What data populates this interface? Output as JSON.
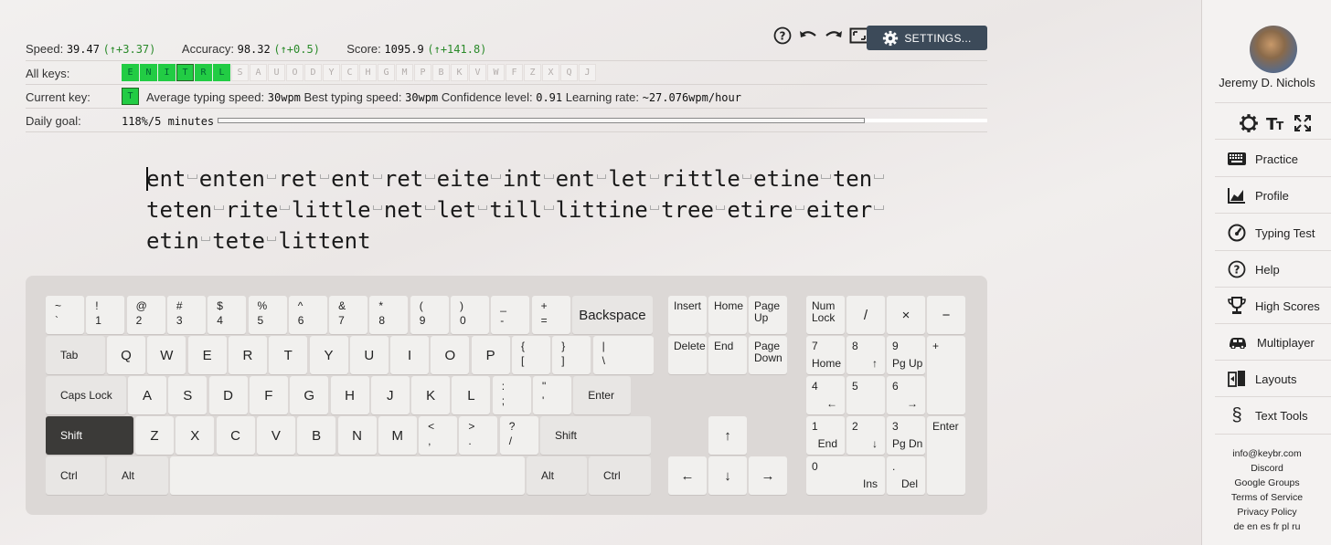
{
  "stats": {
    "speed_label": "Speed:",
    "speed_value": "39.47",
    "speed_delta": "(↑+3.37)",
    "accuracy_label": "Accuracy:",
    "accuracy_value": "98.32",
    "accuracy_delta": "(↑+0.5)",
    "score_label": "Score:",
    "score_value": "1095.9",
    "score_delta": "(↑+141.8)"
  },
  "toolbar": {
    "settings_label": "SETTINGS..."
  },
  "all_keys": {
    "label": "All keys:",
    "keys": [
      {
        "k": "E",
        "on": true
      },
      {
        "k": "N",
        "on": true
      },
      {
        "k": "I",
        "on": true
      },
      {
        "k": "T",
        "on": true,
        "current": true
      },
      {
        "k": "R",
        "on": true
      },
      {
        "k": "L",
        "on": true
      },
      {
        "k": "S",
        "on": false
      },
      {
        "k": "A",
        "on": false
      },
      {
        "k": "U",
        "on": false
      },
      {
        "k": "O",
        "on": false
      },
      {
        "k": "D",
        "on": false
      },
      {
        "k": "Y",
        "on": false
      },
      {
        "k": "C",
        "on": false
      },
      {
        "k": "H",
        "on": false
      },
      {
        "k": "G",
        "on": false
      },
      {
        "k": "M",
        "on": false
      },
      {
        "k": "P",
        "on": false
      },
      {
        "k": "B",
        "on": false
      },
      {
        "k": "K",
        "on": false
      },
      {
        "k": "V",
        "on": false
      },
      {
        "k": "W",
        "on": false
      },
      {
        "k": "F",
        "on": false
      },
      {
        "k": "Z",
        "on": false
      },
      {
        "k": "X",
        "on": false
      },
      {
        "k": "Q",
        "on": false
      },
      {
        "k": "J",
        "on": false
      }
    ]
  },
  "current_key": {
    "label": "Current key:",
    "key": "T",
    "avg_label": "Average typing speed:",
    "avg_value": "30wpm",
    "best_label": "Best typing speed:",
    "best_value": "30wpm",
    "conf_label": "Confidence level:",
    "conf_value": "0.91",
    "rate_label": "Learning rate:",
    "rate_value": "~27.076wpm/hour"
  },
  "daily_goal": {
    "label": "Daily goal:",
    "value": "118%/5 minutes",
    "progress": 1.18
  },
  "practice_text": {
    "lines": [
      "ent enten ret ent ret eite int ent let rittle etine ten ",
      "teten rite little net let till littine tree etire eiter ",
      "etin tete littent"
    ]
  },
  "keyboard": {
    "row1": [
      [
        "~",
        "`"
      ],
      [
        "!",
        "1"
      ],
      [
        "@",
        "2"
      ],
      [
        "#",
        "3"
      ],
      [
        "$",
        "4"
      ],
      [
        "%",
        "5"
      ],
      [
        "^",
        "6"
      ],
      [
        "&",
        "7"
      ],
      [
        "*",
        "8"
      ],
      [
        "(",
        "9"
      ],
      [
        ")",
        "0"
      ],
      [
        "_",
        "-"
      ],
      [
        "+",
        "="
      ]
    ],
    "backspace": "Backspace",
    "tab": "Tab",
    "row2": [
      "Q",
      "W",
      "E",
      "R",
      "T",
      "Y",
      "U",
      "I",
      "O",
      "P"
    ],
    "row2_sym": [
      [
        "{",
        "["
      ],
      [
        "}",
        "]"
      ],
      [
        "|",
        "\\"
      ]
    ],
    "caps": "Caps Lock",
    "row3": [
      "A",
      "S",
      "D",
      "F",
      "G",
      "H",
      "J",
      "K",
      "L"
    ],
    "row3_sym": [
      [
        ":",
        ";"
      ],
      [
        "\"",
        "'"
      ]
    ],
    "enter": "Enter",
    "shift": "Shift",
    "row4": [
      "Z",
      "X",
      "C",
      "V",
      "B",
      "N",
      "M"
    ],
    "row4_sym": [
      [
        "<",
        ","
      ],
      [
        ">",
        "."
      ],
      [
        "?",
        "/"
      ]
    ],
    "ctrl": "Ctrl",
    "alt": "Alt",
    "nav": {
      "insert": "Insert",
      "home": "Home",
      "page_up": "Page Up",
      "delete": "Delete",
      "end": "End",
      "page_down": "Page Down"
    },
    "arrows": {
      "up": "↑",
      "left": "←",
      "down": "↓",
      "right": "→"
    },
    "numpad": {
      "num_lock": "Num Lock",
      "div": "/",
      "mul": "×",
      "minus": "−",
      "plus": "+",
      "enter": "Enter",
      "n7": "7",
      "n7s": "Home",
      "n8": "8",
      "n8s": "↑",
      "n9": "9",
      "n9s": "Pg Up",
      "n4": "4",
      "n4s": "←",
      "n5": "5",
      "n6": "6",
      "n6s": "→",
      "n1": "1",
      "n1s": "End",
      "n2": "2",
      "n2s": "↓",
      "n3": "3",
      "n3s": "Pg Dn",
      "n0": "0",
      "n0s": "Ins",
      "dot": ".",
      "dots": "Del"
    }
  },
  "sidebar": {
    "username": "Jeremy D. Nichols",
    "items": [
      "Practice",
      "Profile",
      "Typing Test",
      "Help",
      "High Scores",
      "Multiplayer",
      "Layouts",
      "Text Tools"
    ],
    "footer": [
      "info@keybr.com",
      "Discord",
      "Google Groups",
      "Terms of Service",
      "Privacy Policy",
      "de en es fr pl ru"
    ]
  }
}
